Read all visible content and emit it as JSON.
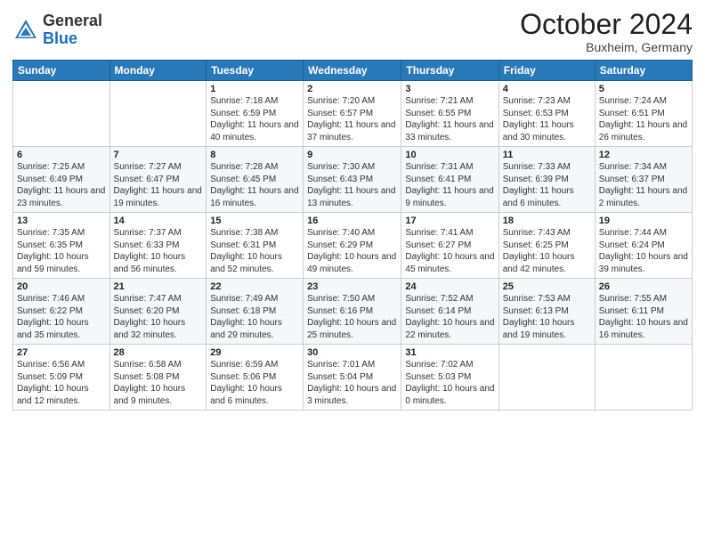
{
  "header": {
    "logo_general": "General",
    "logo_blue": "Blue",
    "month": "October 2024",
    "location": "Buxheim, Germany"
  },
  "days_of_week": [
    "Sunday",
    "Monday",
    "Tuesday",
    "Wednesday",
    "Thursday",
    "Friday",
    "Saturday"
  ],
  "weeks": [
    [
      {
        "day": "",
        "detail": ""
      },
      {
        "day": "",
        "detail": ""
      },
      {
        "day": "1",
        "detail": "Sunrise: 7:18 AM\nSunset: 6:59 PM\nDaylight: 11 hours\nand 40 minutes."
      },
      {
        "day": "2",
        "detail": "Sunrise: 7:20 AM\nSunset: 6:57 PM\nDaylight: 11 hours\nand 37 minutes."
      },
      {
        "day": "3",
        "detail": "Sunrise: 7:21 AM\nSunset: 6:55 PM\nDaylight: 11 hours\nand 33 minutes."
      },
      {
        "day": "4",
        "detail": "Sunrise: 7:23 AM\nSunset: 6:53 PM\nDaylight: 11 hours\nand 30 minutes."
      },
      {
        "day": "5",
        "detail": "Sunrise: 7:24 AM\nSunset: 6:51 PM\nDaylight: 11 hours\nand 26 minutes."
      }
    ],
    [
      {
        "day": "6",
        "detail": "Sunrise: 7:25 AM\nSunset: 6:49 PM\nDaylight: 11 hours\nand 23 minutes."
      },
      {
        "day": "7",
        "detail": "Sunrise: 7:27 AM\nSunset: 6:47 PM\nDaylight: 11 hours\nand 19 minutes."
      },
      {
        "day": "8",
        "detail": "Sunrise: 7:28 AM\nSunset: 6:45 PM\nDaylight: 11 hours\nand 16 minutes."
      },
      {
        "day": "9",
        "detail": "Sunrise: 7:30 AM\nSunset: 6:43 PM\nDaylight: 11 hours\nand 13 minutes."
      },
      {
        "day": "10",
        "detail": "Sunrise: 7:31 AM\nSunset: 6:41 PM\nDaylight: 11 hours\nand 9 minutes."
      },
      {
        "day": "11",
        "detail": "Sunrise: 7:33 AM\nSunset: 6:39 PM\nDaylight: 11 hours\nand 6 minutes."
      },
      {
        "day": "12",
        "detail": "Sunrise: 7:34 AM\nSunset: 6:37 PM\nDaylight: 11 hours\nand 2 minutes."
      }
    ],
    [
      {
        "day": "13",
        "detail": "Sunrise: 7:35 AM\nSunset: 6:35 PM\nDaylight: 10 hours\nand 59 minutes."
      },
      {
        "day": "14",
        "detail": "Sunrise: 7:37 AM\nSunset: 6:33 PM\nDaylight: 10 hours\nand 56 minutes."
      },
      {
        "day": "15",
        "detail": "Sunrise: 7:38 AM\nSunset: 6:31 PM\nDaylight: 10 hours\nand 52 minutes."
      },
      {
        "day": "16",
        "detail": "Sunrise: 7:40 AM\nSunset: 6:29 PM\nDaylight: 10 hours\nand 49 minutes."
      },
      {
        "day": "17",
        "detail": "Sunrise: 7:41 AM\nSunset: 6:27 PM\nDaylight: 10 hours\nand 45 minutes."
      },
      {
        "day": "18",
        "detail": "Sunrise: 7:43 AM\nSunset: 6:25 PM\nDaylight: 10 hours\nand 42 minutes."
      },
      {
        "day": "19",
        "detail": "Sunrise: 7:44 AM\nSunset: 6:24 PM\nDaylight: 10 hours\nand 39 minutes."
      }
    ],
    [
      {
        "day": "20",
        "detail": "Sunrise: 7:46 AM\nSunset: 6:22 PM\nDaylight: 10 hours\nand 35 minutes."
      },
      {
        "day": "21",
        "detail": "Sunrise: 7:47 AM\nSunset: 6:20 PM\nDaylight: 10 hours\nand 32 minutes."
      },
      {
        "day": "22",
        "detail": "Sunrise: 7:49 AM\nSunset: 6:18 PM\nDaylight: 10 hours\nand 29 minutes."
      },
      {
        "day": "23",
        "detail": "Sunrise: 7:50 AM\nSunset: 6:16 PM\nDaylight: 10 hours\nand 25 minutes."
      },
      {
        "day": "24",
        "detail": "Sunrise: 7:52 AM\nSunset: 6:14 PM\nDaylight: 10 hours\nand 22 minutes."
      },
      {
        "day": "25",
        "detail": "Sunrise: 7:53 AM\nSunset: 6:13 PM\nDaylight: 10 hours\nand 19 minutes."
      },
      {
        "day": "26",
        "detail": "Sunrise: 7:55 AM\nSunset: 6:11 PM\nDaylight: 10 hours\nand 16 minutes."
      }
    ],
    [
      {
        "day": "27",
        "detail": "Sunrise: 6:56 AM\nSunset: 5:09 PM\nDaylight: 10 hours\nand 12 minutes."
      },
      {
        "day": "28",
        "detail": "Sunrise: 6:58 AM\nSunset: 5:08 PM\nDaylight: 10 hours\nand 9 minutes."
      },
      {
        "day": "29",
        "detail": "Sunrise: 6:59 AM\nSunset: 5:06 PM\nDaylight: 10 hours\nand 6 minutes."
      },
      {
        "day": "30",
        "detail": "Sunrise: 7:01 AM\nSunset: 5:04 PM\nDaylight: 10 hours\nand 3 minutes."
      },
      {
        "day": "31",
        "detail": "Sunrise: 7:02 AM\nSunset: 5:03 PM\nDaylight: 10 hours\nand 0 minutes."
      },
      {
        "day": "",
        "detail": ""
      },
      {
        "day": "",
        "detail": ""
      }
    ]
  ]
}
